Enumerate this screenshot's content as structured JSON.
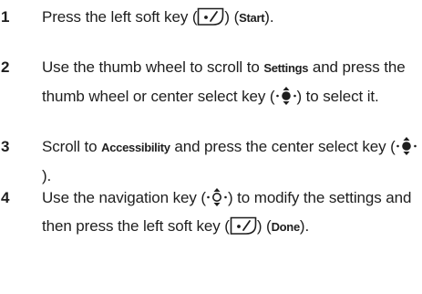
{
  "steps": [
    {
      "number": "1",
      "text": {
        "a": "Press the left soft key (",
        "icon": "left-soft-key-icon",
        "b": ") (",
        "term": "Start",
        "c": ")."
      }
    },
    {
      "number": "2",
      "text": {
        "a": "Use the thumb wheel to scroll to ",
        "term": "Settings",
        "b": " and press the thumb wheel or center select key (",
        "icon": "center-select-key-icon",
        "c": ") to select it."
      }
    },
    {
      "number": "3",
      "text": {
        "a": "Scroll to ",
        "term": "Accessibility",
        "b": " and press the center select key (",
        "icon": "center-select-key-icon",
        "c": ")."
      }
    },
    {
      "number": "4",
      "text": {
        "a": "Use the navigation key (",
        "icon": "navigation-key-icon",
        "b": ") to modify the settings and then press the left soft key (",
        "icon2": "left-soft-key-icon",
        "c": ") (",
        "term": "Done",
        "d": ")."
      }
    }
  ]
}
